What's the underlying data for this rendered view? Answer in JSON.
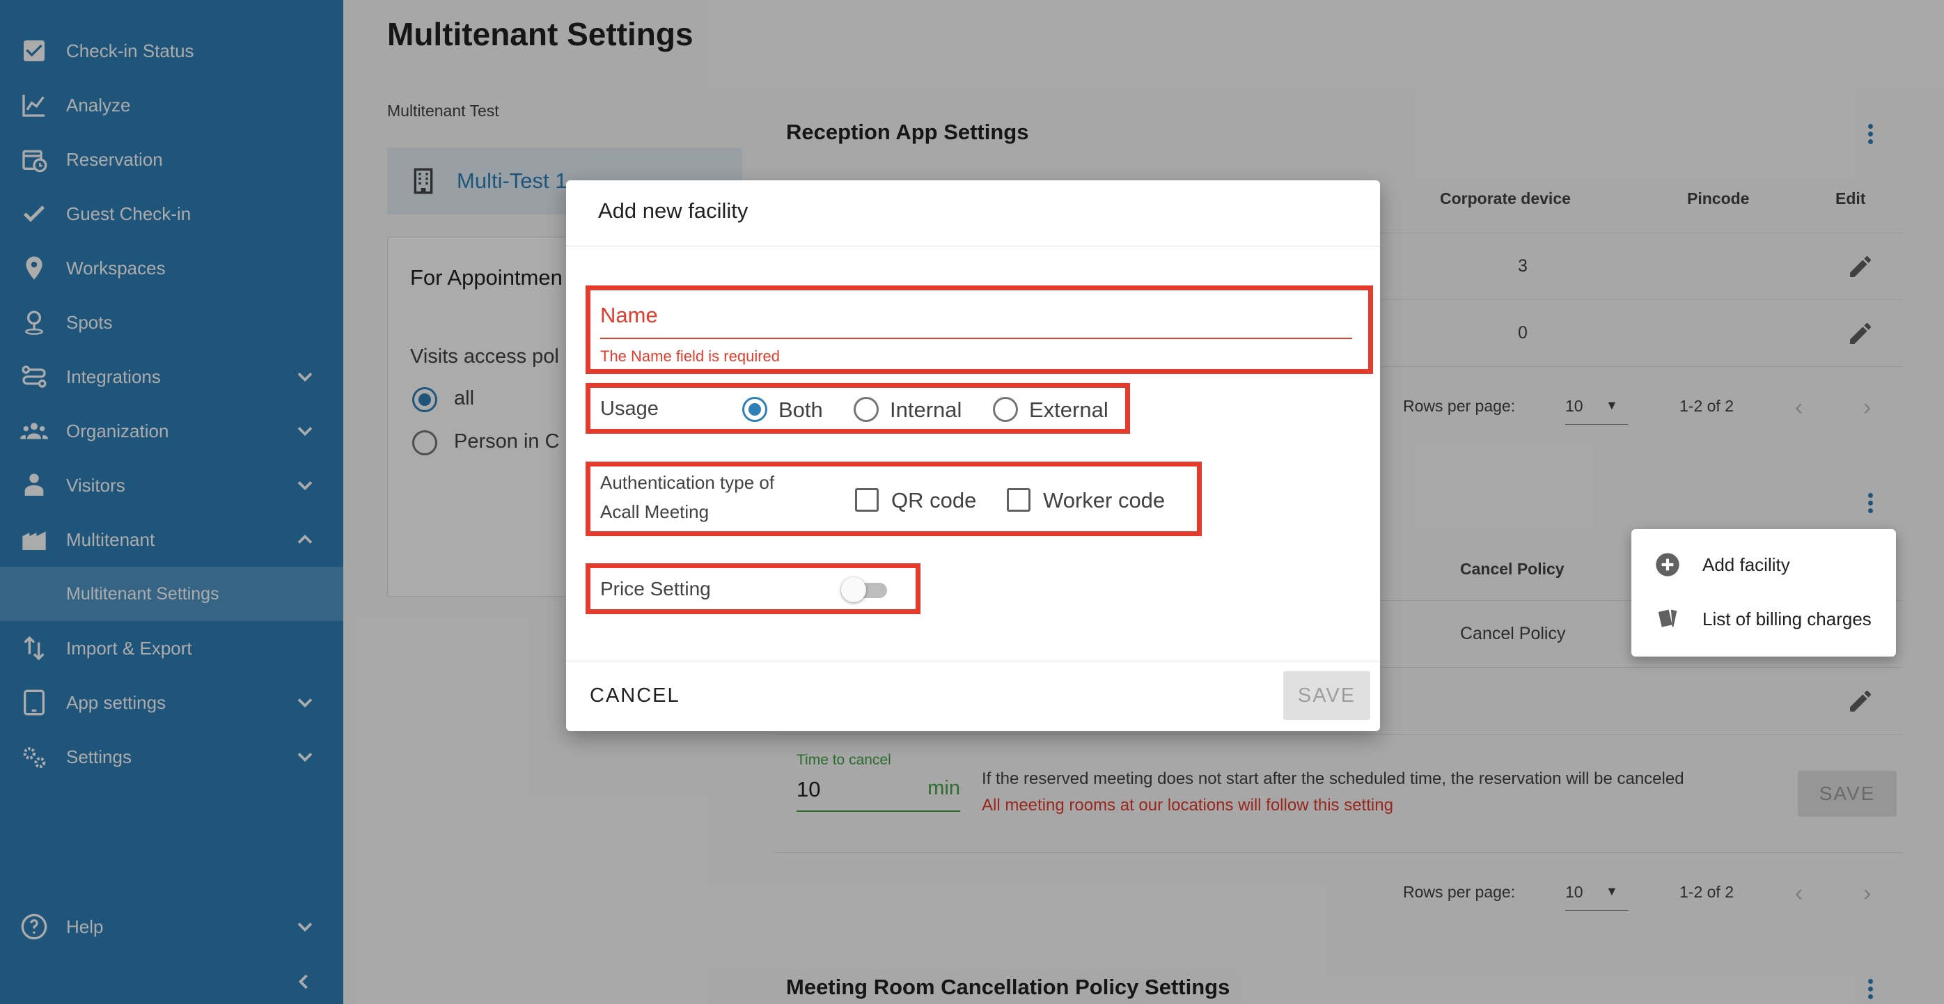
{
  "sidebar": {
    "items": [
      {
        "label": "Check-in Status",
        "icon": "checkbox-icon"
      },
      {
        "label": "Analyze",
        "icon": "chart-line-icon"
      },
      {
        "label": "Reservation",
        "icon": "calendar-clock-icon"
      },
      {
        "label": "Guest Check-in",
        "icon": "check-icon"
      },
      {
        "label": "Workspaces",
        "icon": "map-pin-icon"
      },
      {
        "label": "Spots",
        "icon": "spot-pin-icon"
      },
      {
        "label": "Integrations",
        "icon": "integrations-icon"
      },
      {
        "label": "Organization",
        "icon": "people-icon"
      },
      {
        "label": "Visitors",
        "icon": "visitor-icon"
      },
      {
        "label": "Multitenant",
        "icon": "buildings-icon"
      },
      {
        "label": "Multitenant Settings"
      },
      {
        "label": "Import & Export",
        "icon": "import-export-icon"
      },
      {
        "label": "App settings",
        "icon": "tablet-icon"
      },
      {
        "label": "Settings",
        "icon": "gears-icon"
      },
      {
        "label": "Help",
        "icon": "help-icon"
      }
    ],
    "colors": {
      "background": "#2f7fb8",
      "active": "#4f95c6"
    }
  },
  "main": {
    "page_title": "Multitenant Settings",
    "tenant_section_label": "Multitenant Test",
    "tenant_item": "Multi-Test 1",
    "appointment_title": "For Appointmen",
    "visits_access_label": "Visits access pol",
    "radio_all": "all",
    "radio_person": "Person in C",
    "reception": {
      "title": "Reception App Settings",
      "headers": {
        "corporate": "Corporate device",
        "pincode": "Pincode",
        "edit": "Edit"
      },
      "rows": [
        {
          "corporate": "3"
        },
        {
          "corporate": "0"
        }
      ],
      "rows_per_page_label": "Rows per page:",
      "rows_per_page_value": "10",
      "range": "1-2 of 2"
    },
    "facility": {
      "cancel_policy_header": "Cancel Policy",
      "cancel_policy_value": "Cancel Policy",
      "time_to_cancel_label": "Time to cancel",
      "time_to_cancel_value": "10",
      "time_unit": "min",
      "note": "If the reserved meeting does not start after the scheduled time, the reservation will be canceled",
      "warning": "All meeting rooms at our locations will follow this setting",
      "save_label": "SAVE",
      "rows_per_page_label": "Rows per page:",
      "rows_per_page_value": "10",
      "range": "1-2 of 2"
    },
    "cancellation_title": "Meeting Room Cancellation Policy Settings"
  },
  "menu": {
    "items": [
      {
        "label": "Add facility",
        "icon": "add-circle-icon"
      },
      {
        "label": "List of billing charges",
        "icon": "billing-cards-icon"
      }
    ]
  },
  "dialog": {
    "title": "Add new facility",
    "name_label": "Name",
    "name_error": "The Name field is required",
    "usage_label": "Usage",
    "usage_options": [
      "Both",
      "Internal",
      "External"
    ],
    "usage_selected": "Both",
    "auth_label_line1": "Authentication type of",
    "auth_label_line2": "Acall Meeting",
    "auth_options": [
      "QR code",
      "Worker code"
    ],
    "price_label": "Price Setting",
    "price_enabled": false,
    "cancel_label": "CANCEL",
    "save_label": "SAVE",
    "colors": {
      "error": "#e53b2c",
      "accent": "#2f7fb8"
    }
  }
}
